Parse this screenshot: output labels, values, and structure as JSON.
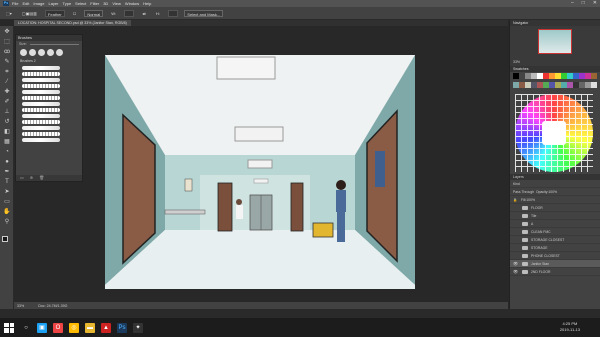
{
  "menu": [
    "File",
    "Edit",
    "Image",
    "Layer",
    "Type",
    "Select",
    "Filter",
    "3D",
    "View",
    "Window",
    "Help"
  ],
  "options": {
    "preset": "Feather",
    "width_label": "W:",
    "height_label": "H:",
    "style": "Normal",
    "select_mask": "Select and Mask..."
  },
  "document_tab": "LOCATION: HOSPITAL SECOND.psd @ 33% (Janitor Stan, RGB/8)",
  "brushes_panel": {
    "title": "Brushes",
    "size_label": "Size:",
    "group": "Brushes 2"
  },
  "status": {
    "zoom": "33%",
    "doc": "Doc: 24.7M/1.39G"
  },
  "navigator": {
    "title": "Navigator",
    "zoom": "33%"
  },
  "swatches_title": "Swatches",
  "layers": {
    "title": "Layers",
    "kind": "Kind",
    "blend": "Pass Through",
    "opacity_label": "Opacity:",
    "opacity": "100%",
    "fill_label": "Fill:",
    "fill": "100%",
    "items": [
      {
        "name": "FLOOR",
        "type": "folder",
        "visible": false
      },
      {
        "name": "Tile",
        "type": "folder",
        "visible": false
      },
      {
        "name": "A",
        "type": "folder",
        "visible": false
      },
      {
        "name": "CLEAN FMC",
        "type": "folder",
        "visible": false
      },
      {
        "name": "STORAGE CLOSEST",
        "type": "folder",
        "visible": false
      },
      {
        "name": "STORAGE",
        "type": "folder",
        "visible": false
      },
      {
        "name": "PHONE CLOSEST",
        "type": "folder",
        "visible": false
      },
      {
        "name": "Janitor Stan",
        "type": "folder",
        "visible": true,
        "selected": true
      },
      {
        "name": "2ND FLOOR",
        "type": "folder",
        "visible": true
      }
    ]
  },
  "taskbar": {
    "time": "4:25 PM",
    "date": "2019-11-13"
  },
  "icons": [
    "search-icon",
    "gear-icon"
  ]
}
